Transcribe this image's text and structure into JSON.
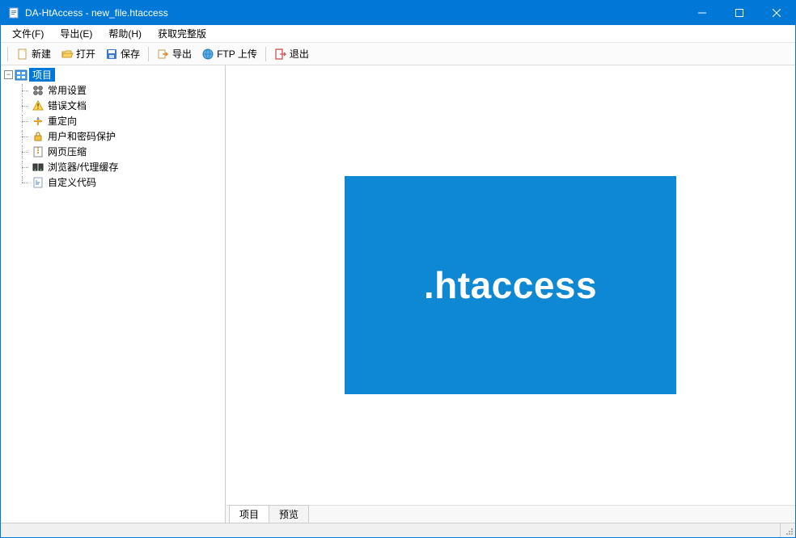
{
  "window": {
    "title": "DA-HtAccess - new_file.htaccess"
  },
  "menu": {
    "file": "文件(F)",
    "export": "导出(E)",
    "help": "帮助(H)",
    "getfull": "获取完整版"
  },
  "toolbar": {
    "new": "新建",
    "open": "打开",
    "save": "保存",
    "export": "导出",
    "ftpupload": "FTP 上传",
    "exit": "退出"
  },
  "tree": {
    "root": "项目",
    "items": [
      {
        "label": "常用设置"
      },
      {
        "label": "错误文档"
      },
      {
        "label": "重定向"
      },
      {
        "label": "用户和密码保护"
      },
      {
        "label": "网页压缩"
      },
      {
        "label": "浏览器/代理缓存"
      },
      {
        "label": "自定义代码"
      }
    ]
  },
  "logo": {
    "text": ".htaccess"
  },
  "tabs": {
    "project": "项目",
    "preview": "预览"
  },
  "colors": {
    "accent": "#0078d7",
    "logo": "#0e88d3"
  }
}
